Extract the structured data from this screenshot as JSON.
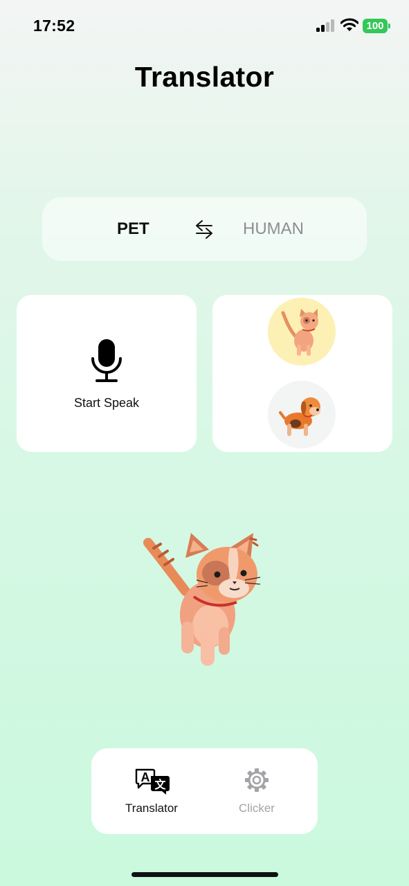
{
  "status_bar": {
    "time": "17:52",
    "battery": "100",
    "icons": [
      "signal-icon",
      "wifi-icon",
      "battery-icon"
    ],
    "battery_color": "#34c759"
  },
  "header": {
    "title": "Translator"
  },
  "language_switch": {
    "source": "PET",
    "target": "HUMAN",
    "swap_icon": "swap-arrows-icon"
  },
  "speak_card": {
    "label": "Start Speak",
    "icon": "microphone-icon"
  },
  "pet_selector": {
    "options": [
      {
        "name": "cat",
        "selected": true,
        "color": "#fdf0b4"
      },
      {
        "name": "dog",
        "selected": false,
        "color": "#f3f4f4"
      }
    ]
  },
  "main_pet": {
    "name": "cat"
  },
  "tab_bar": {
    "tabs": [
      {
        "label": "Translator",
        "icon": "translate-icon",
        "active": true
      },
      {
        "label": "Clicker",
        "icon": "gear-icon",
        "active": false
      }
    ]
  }
}
